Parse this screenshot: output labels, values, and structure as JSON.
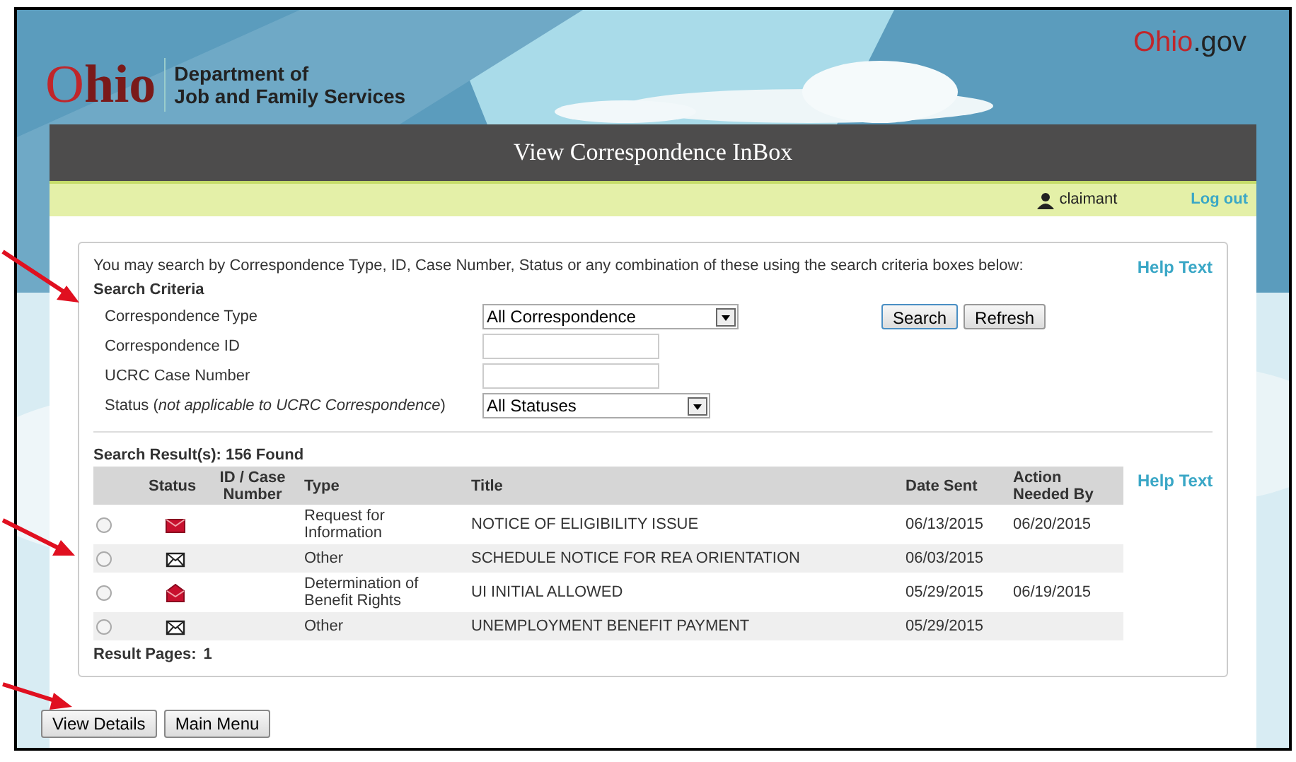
{
  "header": {
    "logo_word": "Ohio",
    "department": [
      "Department of",
      "Job and Family Services"
    ],
    "site_link": "Ohio.gov"
  },
  "title_bar": {
    "title": "View Correspondence InBox"
  },
  "user_bar": {
    "user": "claimant",
    "logout": "Log out"
  },
  "search": {
    "intro": "You may search by Correspondence Type, ID, Case Number, Status or any combination of these using the search criteria boxes below:",
    "help": "Help Text",
    "heading": "Search Criteria",
    "fields": [
      {
        "kind": "select",
        "label": "Correspondence Type",
        "value": "All Correspondence"
      },
      {
        "kind": "text",
        "label": "Correspondence ID"
      },
      {
        "kind": "text",
        "label": "UCRC Case Number"
      },
      {
        "kind": "select",
        "label": "Status (*not applicable to UCRC Correspondence*)",
        "value": "All Statuses"
      }
    ],
    "buttons": [
      "Search",
      "Refresh"
    ]
  },
  "results": {
    "summary": "Search Result(s): 156 Found",
    "help": "Help Text",
    "columns": [
      "Status",
      "ID / Case Number",
      "Type",
      "Title",
      "Date Sent",
      "Action Needed By"
    ],
    "rows": [
      {
        "selected": false,
        "kind": "closed-red",
        "id": "",
        "type": "Request for Information",
        "title": "NOTICE OF ELIGIBILITY ISSUE",
        "date_sent": "06/13/2015",
        "action_needed_by": "06/20/2015"
      },
      {
        "selected": false,
        "kind": "outline",
        "id": "",
        "type": "Other",
        "title": "SCHEDULE NOTICE FOR REA ORIENTATION",
        "date_sent": "06/03/2015",
        "action_needed_by": ""
      },
      {
        "selected": false,
        "kind": "open-red",
        "id": "",
        "type": "Determination of Benefit Rights",
        "title": "UI INITIAL ALLOWED",
        "date_sent": "05/29/2015",
        "action_needed_by": "06/19/2015"
      },
      {
        "selected": false,
        "kind": "outline",
        "id": "",
        "type": "Other",
        "title": "UNEMPLOYMENT BENEFIT PAYMENT",
        "date_sent": "05/29/2015",
        "action_needed_by": ""
      }
    ],
    "pages_label": "Result Pages:",
    "pages": [
      "1"
    ]
  },
  "buttons": [
    "View Details",
    "Main Menu"
  ]
}
